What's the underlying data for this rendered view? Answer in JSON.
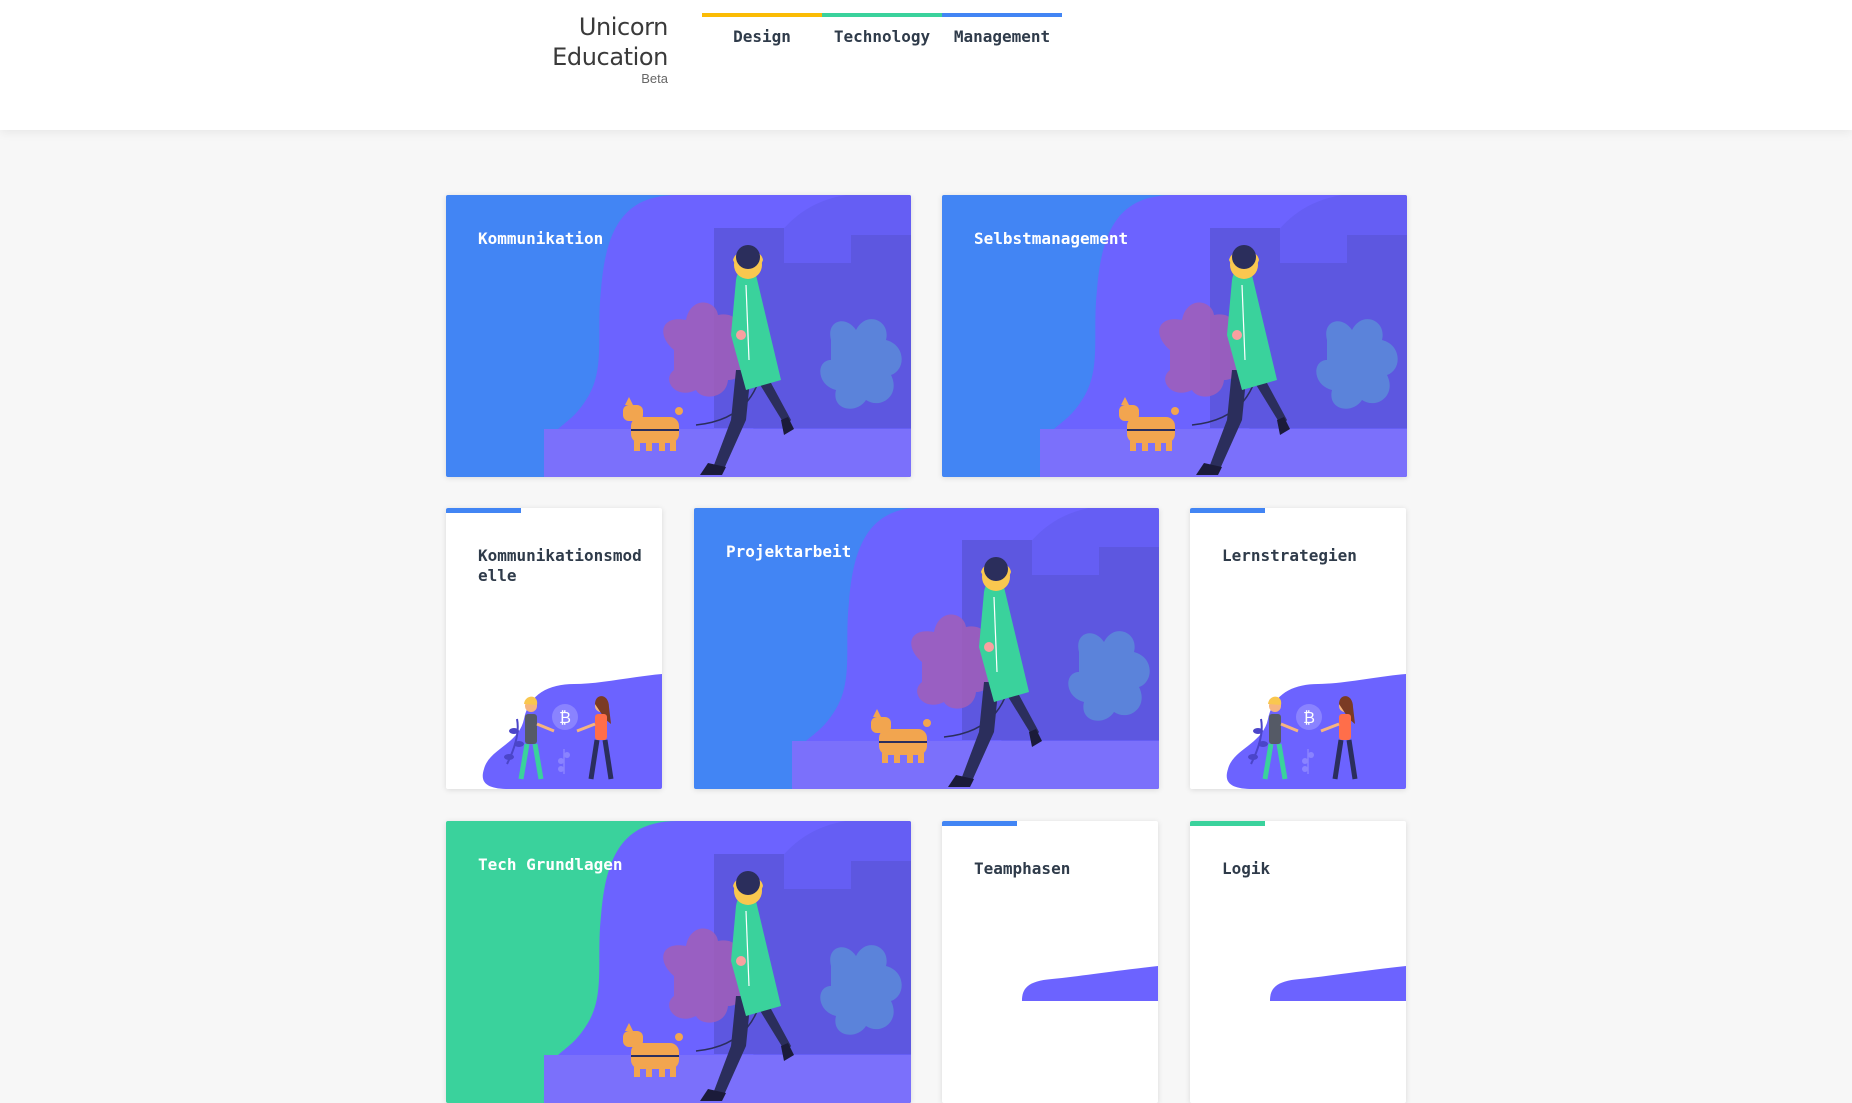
{
  "brand": {
    "title": "Unicorn Education",
    "subtitle": "Beta"
  },
  "nav": [
    {
      "label": "Design",
      "color": "#fbbc05"
    },
    {
      "label": "Technology",
      "color": "#3ad29c"
    },
    {
      "label": "Management",
      "color": "#4285f4"
    }
  ],
  "cards": {
    "kommunikation": {
      "title": "Kommunikation"
    },
    "selbstmanagement": {
      "title": "Selbstmanagement"
    },
    "kommunikationsmodelle": {
      "title": "Kommunikationsmodelle",
      "accent_color": "#4285f4"
    },
    "projektarbeit": {
      "title": "Projektarbeit"
    },
    "lernstrategien": {
      "title": "Lernstrategien",
      "accent_color": "#4285f4"
    },
    "tech_grundlagen": {
      "title": "Tech Grundlagen"
    },
    "teamphasen": {
      "title": "Teamphasen",
      "accent_color": "#4285f4"
    },
    "logik": {
      "title": "Logik",
      "accent_color": "#3ad29c"
    }
  },
  "icons": {
    "coin": "bitcoin-icon"
  },
  "colors": {
    "blue": "#4285f4",
    "green": "#3ad29c",
    "purple": "#6c63ff",
    "yellow": "#fbbc05"
  }
}
